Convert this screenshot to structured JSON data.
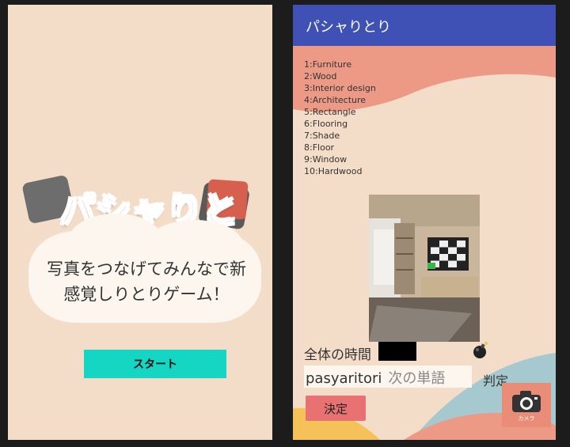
{
  "left_screen": {
    "logo_text": "パシャりとり",
    "tagline_line1": "写真をつなげてみんなで新",
    "tagline_line2": "感覚しりとりゲーム！",
    "start_label": "スタート"
  },
  "right_screen": {
    "appbar_title": "パシャりとり",
    "words": [
      "1:Furniture",
      "2:Wood",
      "3:Interior design",
      "4:Architecture",
      "5:Rectangle",
      "6:Flooring",
      "7:Shade",
      "8:Floor",
      "9:Window",
      "10:Hardwood"
    ],
    "total_time_label": "全体の時間",
    "word_input_value": "pasyaritori",
    "word_input_placeholder": "次の単語",
    "judge_label": "判定",
    "decide_label": "決定",
    "camera_caption": "カメラ"
  },
  "colors": {
    "background": "#f4ddc8",
    "appbar": "#3f51b5",
    "start_button": "#15d6c2",
    "decide_button": "#e87172",
    "camera_button": "#e98d78",
    "wave_salmon": "#ec9a86",
    "wave_blue": "#a6c9cf",
    "wave_yellow": "#f5c25a"
  },
  "icons": [
    "camera-icon",
    "bomb-icon"
  ]
}
